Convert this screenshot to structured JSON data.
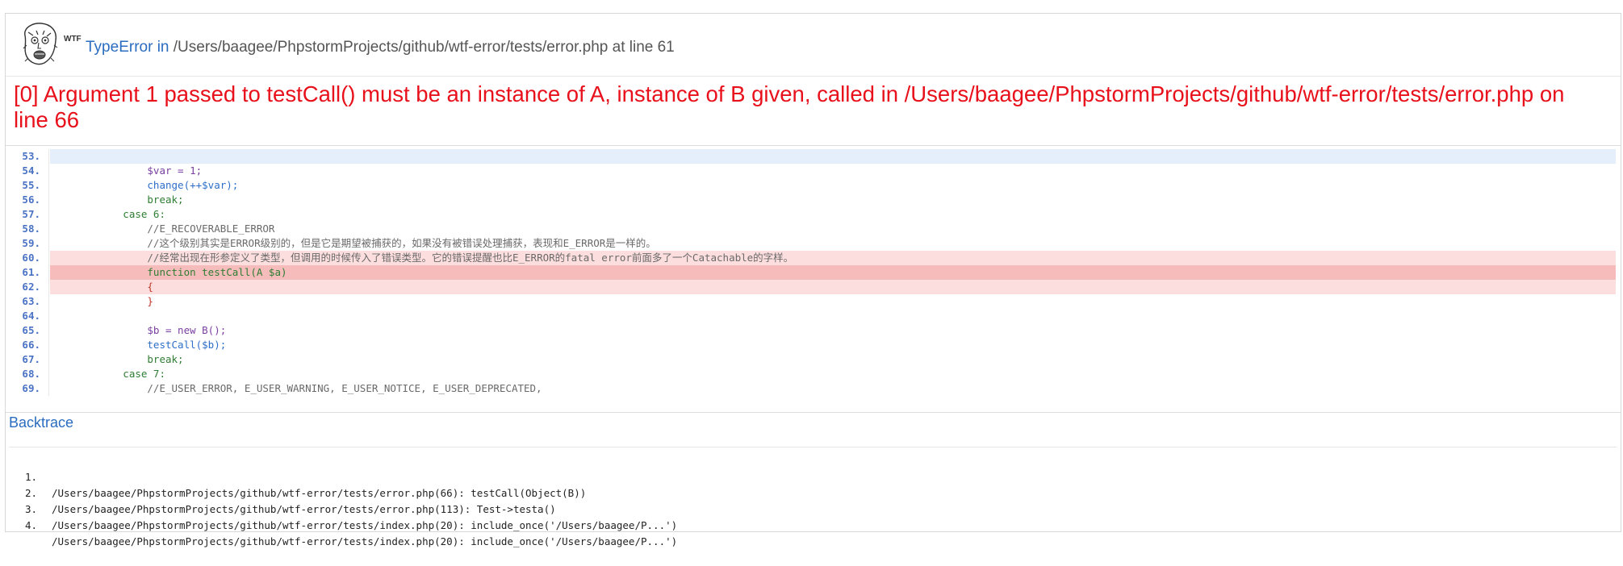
{
  "header": {
    "logo_icon": "rage-face-icon",
    "wtf_label": "WTF",
    "error_type": "TypeError",
    "in_word": "in",
    "file_info": "/Users/baagee/PhpstormProjects/github/wtf-error/tests/error.php at line 61"
  },
  "message": "[0] Argument 1 passed to testCall() must be an instance of A, instance of B given, called in /Users/baagee/PhpstormProjects/github/wtf-error/tests/error.php on line 66",
  "code": {
    "lines": [
      {
        "num": "53.",
        "text": ""
      },
      {
        "num": "54.",
        "text": "                $var = 1;"
      },
      {
        "num": "55.",
        "text": "                change(++$var);"
      },
      {
        "num": "56.",
        "text": "                break;"
      },
      {
        "num": "57.",
        "text": "            case 6:"
      },
      {
        "num": "58.",
        "text": "                //E_RECOVERABLE_ERROR"
      },
      {
        "num": "59.",
        "text": "                //这个级别其实是ERROR级别的，但是它是期望被捕获的，如果没有被错误处理捕获，表现和E_ERROR是一样的。"
      },
      {
        "num": "60.",
        "text": "                //经常出现在形参定义了类型，但调用的时候传入了错误类型。它的错误提醒也比E_ERROR的fatal error前面多了一个Catachable的字样。"
      },
      {
        "num": "61.",
        "text": "                function testCall(A $a)"
      },
      {
        "num": "62.",
        "text": "                {"
      },
      {
        "num": "63.",
        "text": "                }"
      },
      {
        "num": "64.",
        "text": ""
      },
      {
        "num": "65.",
        "text": "                $b = new B();"
      },
      {
        "num": "66.",
        "text": "                testCall($b);"
      },
      {
        "num": "67.",
        "text": "                break;"
      },
      {
        "num": "68.",
        "text": "            case 7:"
      },
      {
        "num": "69.",
        "text": "                //E_USER_ERROR, E_USER_WARNING, E_USER_NOTICE, E_USER_DEPRECATED,"
      }
    ]
  },
  "backtrace": {
    "title": "Backtrace",
    "items": [
      {
        "num": "1.",
        "text": "/Users/baagee/PhpstormProjects/github/wtf-error/tests/error.php(66): testCall(Object(B))"
      },
      {
        "num": "2.",
        "text": "/Users/baagee/PhpstormProjects/github/wtf-error/tests/error.php(113): Test->testa()"
      },
      {
        "num": "3.",
        "text": "/Users/baagee/PhpstormProjects/github/wtf-error/tests/index.php(20): include_once('/Users/baagee/P...')"
      },
      {
        "num": "4.",
        "text": "/Users/baagee/PhpstormProjects/github/wtf-error/tests/index.php(20): include_once('/Users/baagee/P...')"
      }
    ]
  },
  "colors": {
    "error_red": "#e8111b",
    "link_blue": "#2a6cbf",
    "highlight_line": "#f6bcbc",
    "highlight_context": "#fcdede"
  }
}
